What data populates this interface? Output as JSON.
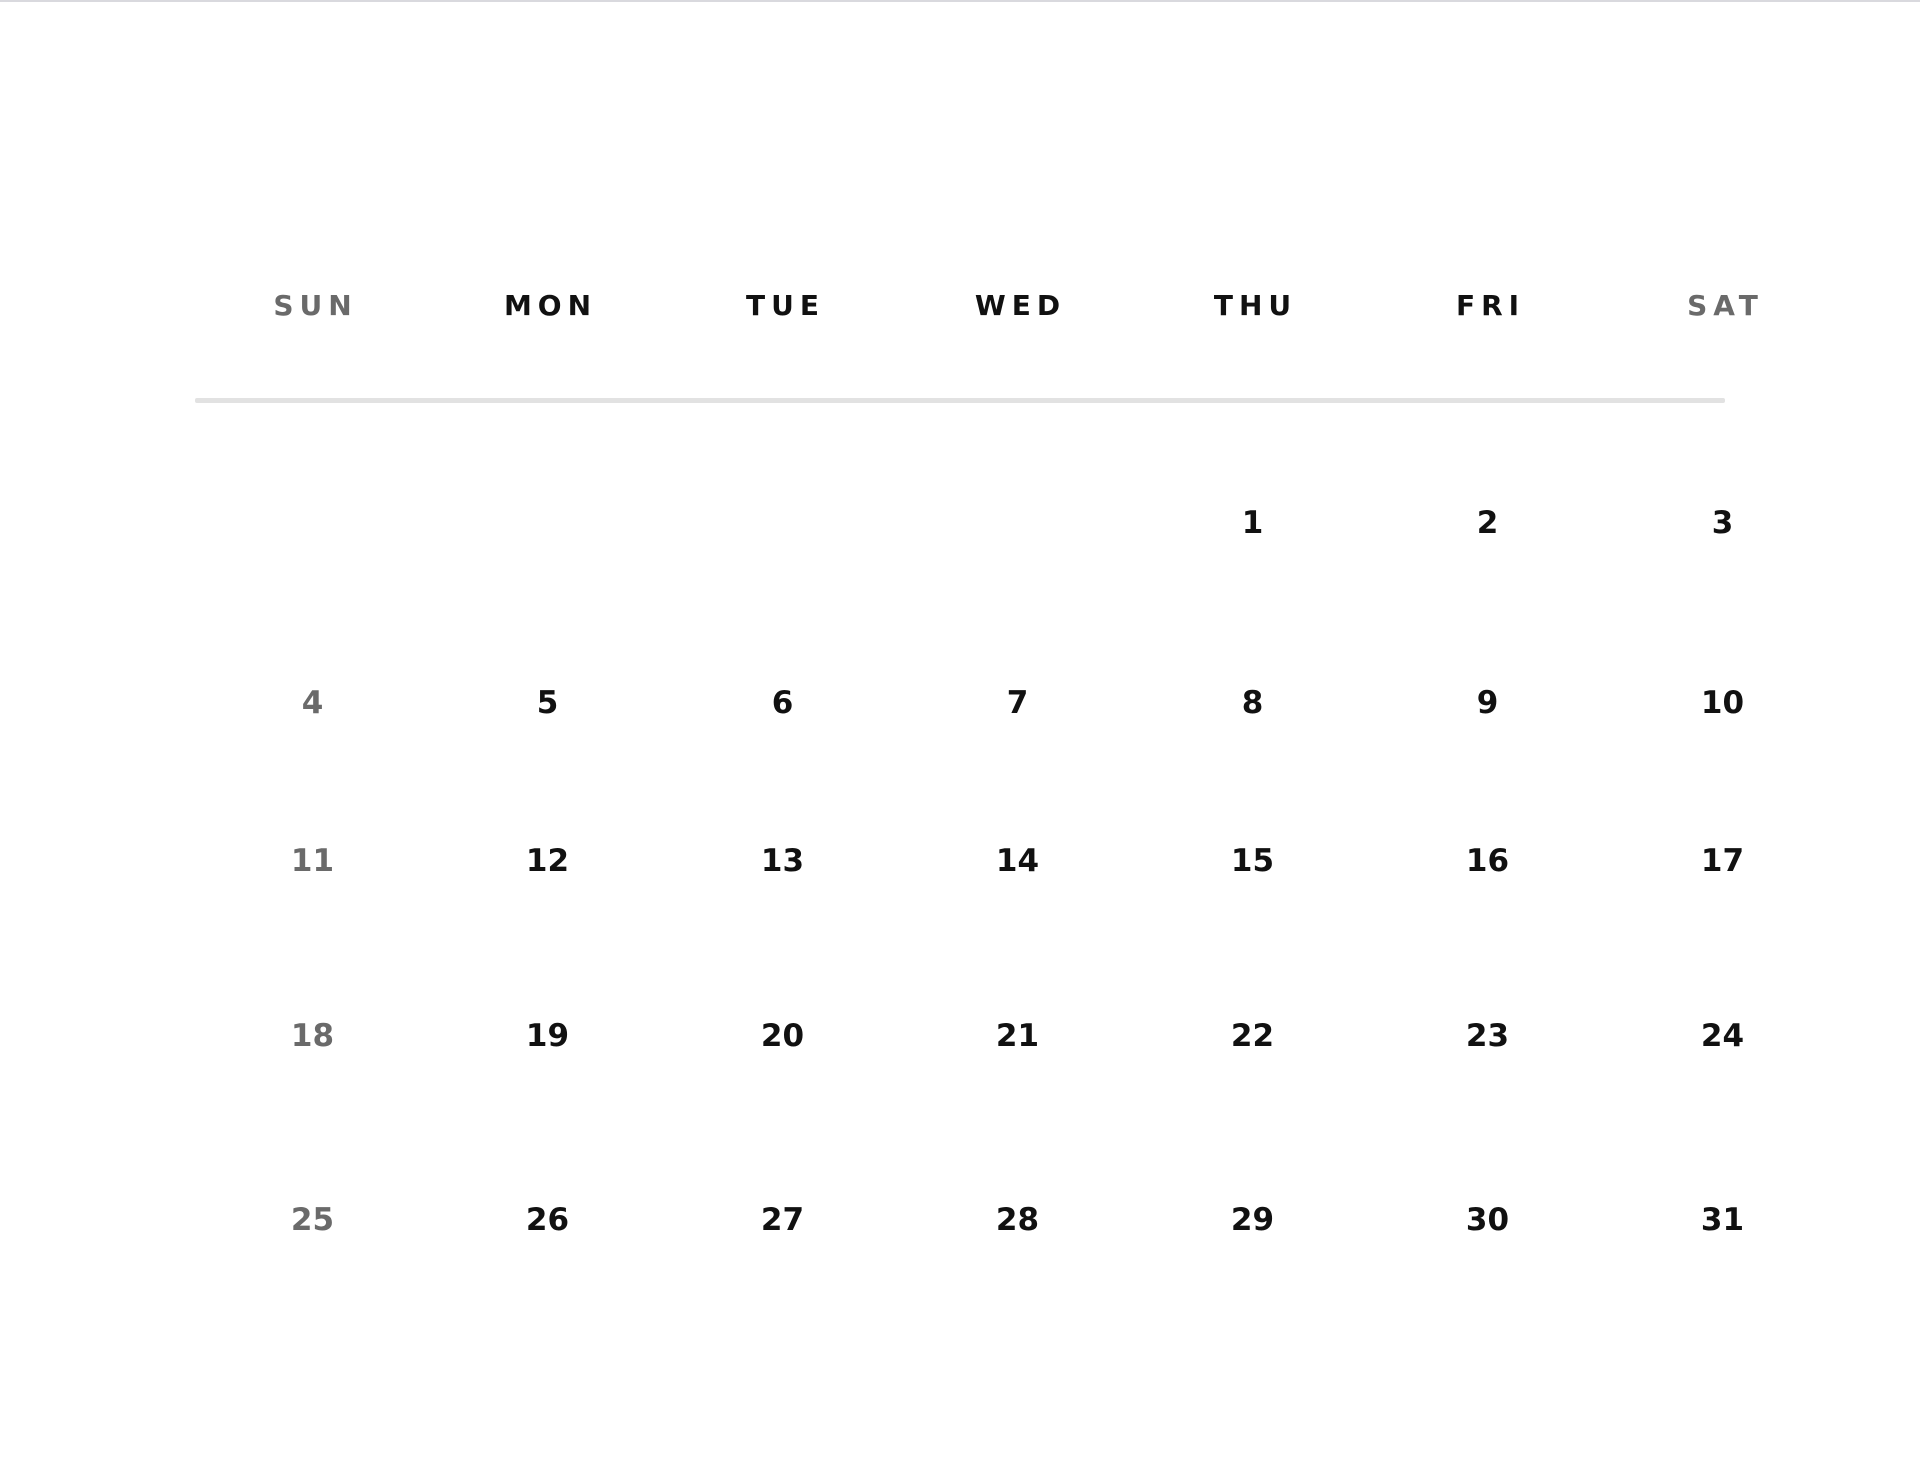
{
  "weekdays": [
    "SUN",
    "MON",
    "TUE",
    "WED",
    "THU",
    "FRI",
    "SAT"
  ],
  "weeks": [
    [
      "",
      "",
      "",
      "",
      "1",
      "2",
      "3"
    ],
    [
      "4",
      "5",
      "6",
      "7",
      "8",
      "9",
      "10"
    ],
    [
      "11",
      "12",
      "13",
      "14",
      "15",
      "16",
      "17"
    ],
    [
      "18",
      "19",
      "20",
      "21",
      "22",
      "23",
      "24"
    ],
    [
      "25",
      "26",
      "27",
      "28",
      "29",
      "30",
      "31"
    ]
  ],
  "colors": {
    "weekday_text": "#111111",
    "weekend_text": "#6a6a6a",
    "divider": "#e2e2e2"
  }
}
